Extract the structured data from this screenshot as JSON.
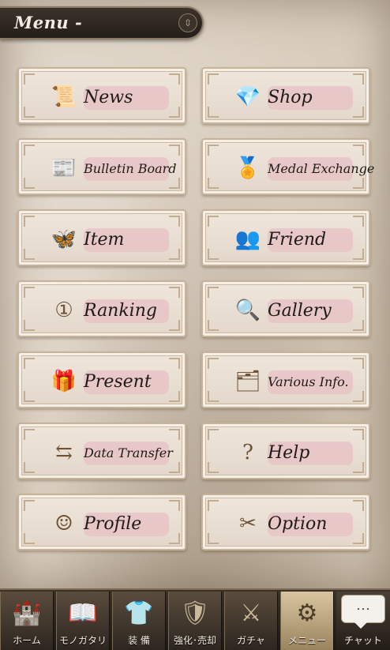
{
  "header": {
    "title": "Menu -",
    "toggle_icon": "collapse-icon"
  },
  "menu": {
    "items": [
      {
        "label": "News",
        "icon": "news-icon",
        "glyph": "📜"
      },
      {
        "label": "Shop",
        "icon": "shop-icon",
        "glyph": "💎"
      },
      {
        "label": "Bulletin Board",
        "icon": "bulletin-board-icon",
        "glyph": "📰"
      },
      {
        "label": "Medal Exchange",
        "icon": "medal-exchange-icon",
        "glyph": "🏅"
      },
      {
        "label": "Item",
        "icon": "butterfly-icon",
        "glyph": "🦋"
      },
      {
        "label": "Friend",
        "icon": "friend-icon",
        "glyph": "👥"
      },
      {
        "label": "Ranking",
        "icon": "ranking-icon",
        "glyph": "①"
      },
      {
        "label": "Gallery",
        "icon": "gallery-icon",
        "glyph": "🔍"
      },
      {
        "label": "Present",
        "icon": "present-icon",
        "glyph": "🎁"
      },
      {
        "label": "Various Info.",
        "icon": "various-info-icon",
        "glyph": "🗂"
      },
      {
        "label": "Data Transfer",
        "icon": "data-transfer-icon",
        "glyph": "⇆"
      },
      {
        "label": "Help",
        "icon": "help-icon",
        "glyph": "?"
      },
      {
        "label": "Profile",
        "icon": "profile-icon",
        "glyph": "☺"
      },
      {
        "label": "Option",
        "icon": "option-icon",
        "glyph": "✂"
      }
    ]
  },
  "bottom_nav": {
    "tabs": [
      {
        "label": "ホーム",
        "icon": "castle-icon",
        "glyph": "🏰"
      },
      {
        "label": "モノガタリ",
        "icon": "book-icon",
        "glyph": "📖"
      },
      {
        "label": "装 備",
        "icon": "equipment-icon",
        "glyph": "👕"
      },
      {
        "label": "強化･売却",
        "icon": "enhance-sell-icon",
        "glyph": "🛡"
      },
      {
        "label": "ガチャ",
        "icon": "gacha-icon",
        "glyph": "⚔"
      },
      {
        "label": "メニュー",
        "icon": "gears-icon",
        "glyph": "⚙"
      }
    ],
    "chat": {
      "label": "チャット",
      "icon": "chat-bubble-icon",
      "glyph": "…"
    }
  },
  "colors": {
    "button_bg": "#efe6dc",
    "label_highlight": "#e7c3c6",
    "nav_bg": "#2d2620",
    "nav_active": "#d8c59f"
  }
}
